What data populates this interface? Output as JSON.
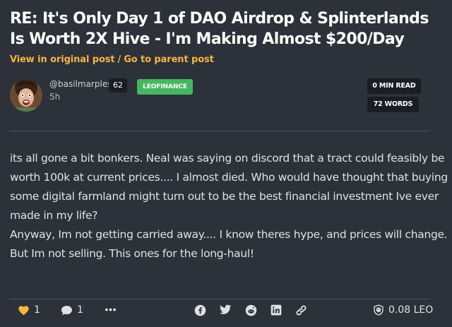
{
  "post": {
    "title": "RE: It's Only Day 1 of DAO Airdrop & Splinterlands Is Worth 2X Hive - I'm Making Almost $200/Day",
    "link_original": "View in original post",
    "link_separator": "/",
    "link_parent": "Go to parent post"
  },
  "author": {
    "username": "@basilmarples",
    "reputation": "62",
    "time_ago": "5h",
    "tag": "LEOFINANCE"
  },
  "stats": {
    "read_time": "0 MIN READ",
    "word_count": "72 WORDS"
  },
  "body": {
    "paragraph_1": "its all gone a bit bonkers. Neal was saying on discord that a tract could feasibly be worth 100k at current prices.... I almost died. Who would have thought that buying some digital farmland might turn out to be the best financial investment Ive ever made in my life?",
    "paragraph_2": "Anyway, Im not getting carried away.... I know theres hype, and prices will change. But Im not selling. This ones for the long-haul!"
  },
  "footer": {
    "likes": "1",
    "comments": "1",
    "payout": "0.08 LEO"
  },
  "colors": {
    "background": "#2d3139",
    "accent_link": "#f5b642",
    "tag_green": "#45b75f",
    "heart": "#f5b642"
  },
  "icons": {
    "like": "heart-icon",
    "comment": "comment-icon",
    "more": "ellipsis-icon",
    "share_facebook": "facebook-icon",
    "share_twitter": "twitter-icon",
    "share_reddit": "reddit-icon",
    "share_linkedin": "linkedin-icon",
    "copy_link": "link-icon",
    "payout": "leo-token-icon"
  }
}
